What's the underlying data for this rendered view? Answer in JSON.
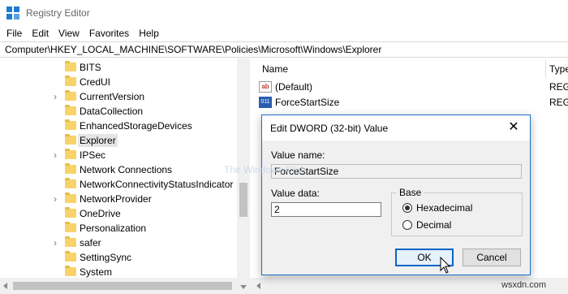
{
  "window": {
    "title": "Registry Editor"
  },
  "menu": [
    "File",
    "Edit",
    "View",
    "Favorites",
    "Help"
  ],
  "address": "Computer\\HKEY_LOCAL_MACHINE\\SOFTWARE\\Policies\\Microsoft\\Windows\\Explorer",
  "tree": [
    {
      "label": "BITS",
      "expandable": false
    },
    {
      "label": "CredUI",
      "expandable": false
    },
    {
      "label": "CurrentVersion",
      "expandable": true
    },
    {
      "label": "DataCollection",
      "expandable": false
    },
    {
      "label": "EnhancedStorageDevices",
      "expandable": false
    },
    {
      "label": "Explorer",
      "expandable": false,
      "selected": true
    },
    {
      "label": "IPSec",
      "expandable": true
    },
    {
      "label": "Network Connections",
      "expandable": false
    },
    {
      "label": "NetworkConnectivityStatusIndicator",
      "expandable": false
    },
    {
      "label": "NetworkProvider",
      "expandable": true
    },
    {
      "label": "OneDrive",
      "expandable": false
    },
    {
      "label": "Personalization",
      "expandable": false
    },
    {
      "label": "safer",
      "expandable": true
    },
    {
      "label": "SettingSync",
      "expandable": false
    },
    {
      "label": "System",
      "expandable": false
    }
  ],
  "list": {
    "headers": {
      "name": "Name",
      "type": "Type"
    },
    "rows": [
      {
        "name": "(Default)",
        "type": "REG_",
        "icon": "ab",
        "icon_name": "string-value-icon"
      },
      {
        "name": "ForceStartSize",
        "type": "REG_",
        "icon": "011",
        "icon_name": "dword-value-icon"
      }
    ]
  },
  "dialog": {
    "title": "Edit DWORD (32-bit) Value",
    "value_name_label": "Value name:",
    "value_name": "ForceStartSize",
    "value_data_label": "Value data:",
    "value_data": "2",
    "base_label": "Base",
    "base_options": [
      {
        "label": "Hexadecimal",
        "checked": true
      },
      {
        "label": "Decimal",
        "checked": false
      }
    ],
    "ok_label": "OK",
    "cancel_label": "Cancel"
  },
  "faint_watermark": "The Windows Club",
  "watermark": "wsxdn.com",
  "colors": {
    "accent": "#1a73c9",
    "folder": "#f7d36a",
    "dialog_bg": "#f0f0f0"
  }
}
